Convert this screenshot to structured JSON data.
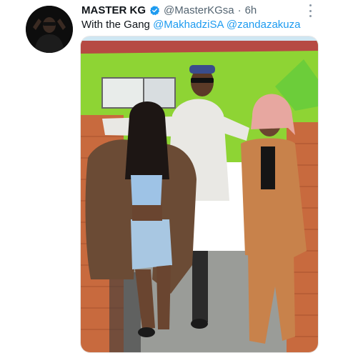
{
  "tweet": {
    "author_name": "MASTER KG",
    "handle": "@MasterKGsa",
    "separator": "·",
    "timestamp": "6h",
    "text_prefix": "With the Gang",
    "mentions": [
      "@MakhadziSA",
      "@zandazakuza"
    ]
  },
  "icons": {
    "verified": "verified-badge-icon",
    "more": "more-options-icon"
  },
  "colors": {
    "mention": "#1d9bf0",
    "verified": "#1d9bf0",
    "wall_green": "#8ed434",
    "brick": "#c86a3e"
  }
}
